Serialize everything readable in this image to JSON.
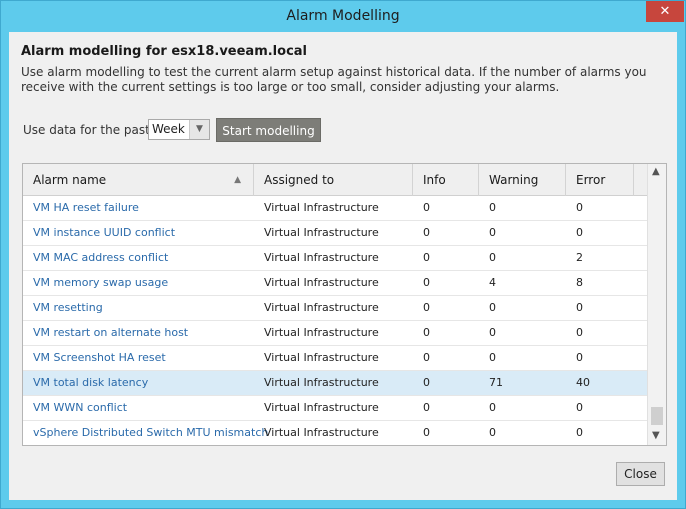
{
  "window": {
    "title": "Alarm Modelling",
    "close_glyph": "✕"
  },
  "heading": "Alarm modelling for esx18.veeam.local",
  "description": "Use alarm modelling to test the current alarm setup against historical data. If the number of alarms you receive with the current settings is too large or too small, consider adjusting your alarms.",
  "controls": {
    "use_label": "Use data for the past",
    "period_value": "Week",
    "start_button": "Start modelling"
  },
  "table": {
    "columns": [
      "Alarm name",
      "Assigned to",
      "Info",
      "Warning",
      "Error"
    ],
    "sort_column": "Alarm name",
    "sort_direction": "ascending",
    "selected_row": 7,
    "rows": [
      {
        "name": "VM HA reset failure",
        "assigned": "Virtual Infrastructure",
        "info": "0",
        "warning": "0",
        "error": "0"
      },
      {
        "name": "VM instance UUID conflict",
        "assigned": "Virtual Infrastructure",
        "info": "0",
        "warning": "0",
        "error": "0"
      },
      {
        "name": "VM MAC address conflict",
        "assigned": "Virtual Infrastructure",
        "info": "0",
        "warning": "0",
        "error": "2"
      },
      {
        "name": "VM memory swap usage",
        "assigned": "Virtual Infrastructure",
        "info": "0",
        "warning": "4",
        "error": "8"
      },
      {
        "name": "VM resetting",
        "assigned": "Virtual Infrastructure",
        "info": "0",
        "warning": "0",
        "error": "0"
      },
      {
        "name": "VM restart on alternate host",
        "assigned": "Virtual Infrastructure",
        "info": "0",
        "warning": "0",
        "error": "0"
      },
      {
        "name": "VM Screenshot HA reset",
        "assigned": "Virtual Infrastructure",
        "info": "0",
        "warning": "0",
        "error": "0"
      },
      {
        "name": "VM total disk latency",
        "assigned": "Virtual Infrastructure",
        "info": "0",
        "warning": "71",
        "error": "40"
      },
      {
        "name": "VM WWN conflict",
        "assigned": "Virtual Infrastructure",
        "info": "0",
        "warning": "0",
        "error": "0"
      },
      {
        "name": "vSphere Distributed Switch MTU mismatch",
        "assigned": "Virtual Infrastructure",
        "info": "0",
        "warning": "0",
        "error": "0"
      }
    ]
  },
  "footer": {
    "close_button": "Close"
  },
  "colors": {
    "frame": "#5ecbec",
    "close_x": "#c7463d",
    "link": "#2a6aaa",
    "selected_row": "#d9ebf7",
    "start_button": "#7d7d78"
  }
}
